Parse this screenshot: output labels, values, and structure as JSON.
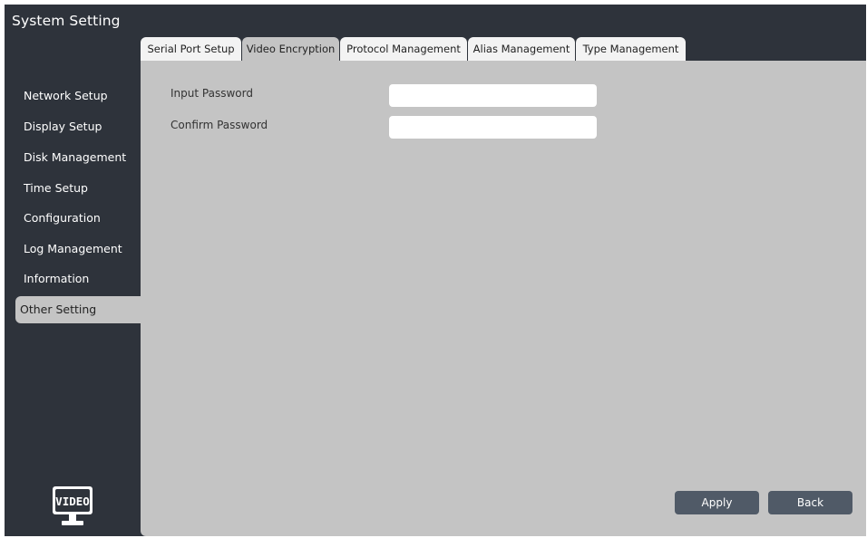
{
  "window": {
    "title": "System Setting"
  },
  "tabs": [
    {
      "label": "Serial Port Setup",
      "active": false
    },
    {
      "label": "Video Encryption",
      "active": true
    },
    {
      "label": "Protocol Management",
      "active": false
    },
    {
      "label": "Alias Management",
      "active": false
    },
    {
      "label": "Type Management",
      "active": false
    }
  ],
  "sidebar": {
    "items": [
      {
        "label": "Network Setup",
        "active": false
      },
      {
        "label": "Display Setup",
        "active": false
      },
      {
        "label": "Disk Management",
        "active": false
      },
      {
        "label": "Time Setup",
        "active": false
      },
      {
        "label": "Configuration",
        "active": false
      },
      {
        "label": "Log Management",
        "active": false
      },
      {
        "label": "Information",
        "active": false
      },
      {
        "label": "Other Setting",
        "active": true
      }
    ],
    "logo": {
      "text": "VIDEO",
      "icon": "video-monitor-logo-icon"
    }
  },
  "form": {
    "input_password": {
      "label": "Input Password",
      "value": ""
    },
    "confirm_password": {
      "label": "Confirm Password",
      "value": ""
    }
  },
  "buttons": {
    "apply": "Apply",
    "back": "Back"
  },
  "colors": {
    "window_bg": "#2e333b",
    "panel_bg": "#c4c4c4",
    "tab_bg": "#f3f3f3",
    "button_bg": "#505a67"
  }
}
